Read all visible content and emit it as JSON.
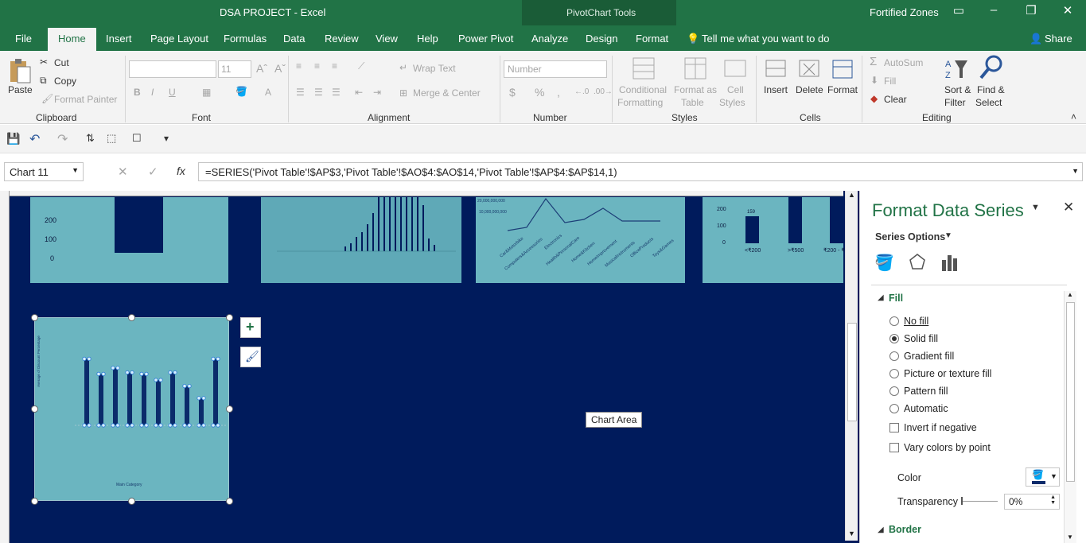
{
  "window": {
    "title": "DSA PROJECT  -  Excel",
    "contextual_tab_group": "PivotChart Tools",
    "user": "Fortified Zones"
  },
  "tabs": [
    "File",
    "Home",
    "Insert",
    "Page Layout",
    "Formulas",
    "Data",
    "Review",
    "View",
    "Help",
    "Power Pivot",
    "Analyze",
    "Design",
    "Format"
  ],
  "tell_me": "Tell me what you want to do",
  "share": "Share",
  "ribbon": {
    "clipboard": {
      "label": "Clipboard",
      "paste": "Paste",
      "cut": "Cut",
      "copy": "Copy",
      "format_painter": "Format Painter"
    },
    "font": {
      "label": "Font",
      "font_name": "",
      "font_size": "11"
    },
    "alignment": {
      "label": "Alignment",
      "wrap_text": "Wrap Text",
      "merge_center": "Merge & Center"
    },
    "number": {
      "label": "Number",
      "format": "Number",
      "currency": "$",
      "percent": "%",
      "comma": ","
    },
    "styles": {
      "label": "Styles",
      "conditional_1": "Conditional",
      "conditional_2": "Formatting",
      "format_table_1": "Format as",
      "format_table_2": "Table",
      "cell_styles_1": "Cell",
      "cell_styles_2": "Styles"
    },
    "cells": {
      "label": "Cells",
      "insert": "Insert",
      "delete": "Delete",
      "format": "Format"
    },
    "editing": {
      "label": "Editing",
      "autosum": "AutoSum",
      "fill": "Fill",
      "clear": "Clear",
      "sort_1": "Sort &",
      "sort_2": "Filter",
      "find_1": "Find &",
      "find_2": "Select"
    }
  },
  "formula_bar": {
    "name_box": "Chart 11",
    "fx": "fx",
    "formula": "=SERIES('Pivot Table'!$AP$3,'Pivot Table'!$AO$4:$AO$14,'Pivot Table'!$AP$4:$AP$14,1)"
  },
  "sheet": {
    "tooltip": "Chart Area",
    "chart_a_ticks": [
      "200",
      "100",
      "0"
    ],
    "chart_b_ticks": [
      "200",
      "100",
      "0"
    ],
    "chart_b_categories": [
      "<₹200",
      ">₹500",
      "₹200 - ₹"
    ],
    "chart_b_value": "159",
    "chart_c_categories": [
      "Car&Motorbike",
      "Computers&Accessories",
      "Electronics",
      "Health&PersonalCare",
      "Home&Kitchen",
      "HomeImprovement",
      "MusicalInstruments",
      "OfficeProducts",
      "Toys&Games"
    ],
    "chart_c_top": "20,000,000,000",
    "chart_c_top2": "10,000,000,000",
    "selected_chart": {
      "y_title": "Average of Discount Percentage",
      "x_title": "Main Category"
    }
  },
  "chart_data": {
    "type": "bar",
    "ylabel": "Average of Discount Percentage",
    "xlabel": "Main Category",
    "values": [
      0.44,
      0.34,
      0.38,
      0.35,
      0.34,
      0.3,
      0.35,
      0.26,
      0.18,
      0.44
    ],
    "ylim": [
      0,
      0.5
    ],
    "grid": false
  },
  "pane": {
    "title": "Format Data Series",
    "series_options": "Series Options",
    "fill_header": "Fill",
    "fill_options": [
      "No fill",
      "Solid fill",
      "Gradient fill",
      "Picture or texture fill",
      "Pattern fill",
      "Automatic"
    ],
    "selected_fill": "Solid fill",
    "invert": "Invert if negative",
    "vary": "Vary colors by point",
    "color_label": "Color",
    "transparency_label": "Transparency",
    "transparency_value": "0%",
    "border_header": "Border",
    "fill_color": "#0b2b6b"
  }
}
